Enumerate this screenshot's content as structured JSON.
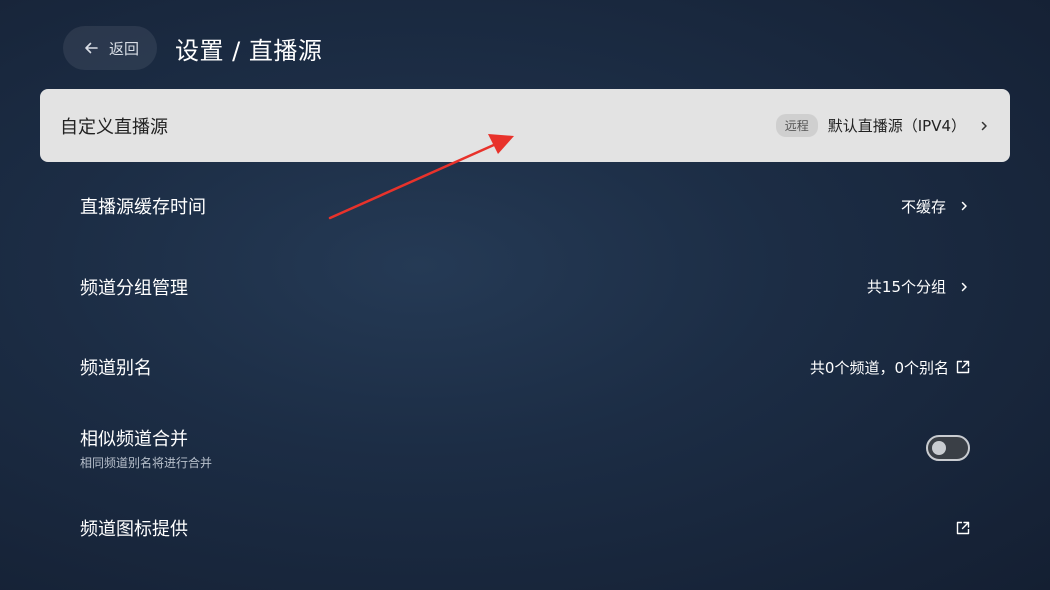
{
  "header": {
    "back_label": "返回",
    "title": "设置 / 直播源"
  },
  "rows": [
    {
      "title": "自定义直播源",
      "badge": "远程",
      "value": "默认直播源（IPV4）"
    },
    {
      "title": "直播源缓存时间",
      "value": "不缓存"
    },
    {
      "title": "频道分组管理",
      "value": "共15个分组"
    },
    {
      "title": "频道别名",
      "value": "共0个频道，0个别名"
    },
    {
      "title": "相似频道合并",
      "subtitle": "相同频道别名将进行合并",
      "toggle_on": false
    },
    {
      "title": "频道图标提供",
      "value": ""
    }
  ],
  "colors": {
    "annotation_arrow": "#e8322b",
    "focused_row_bg": "#e3e3e3"
  }
}
